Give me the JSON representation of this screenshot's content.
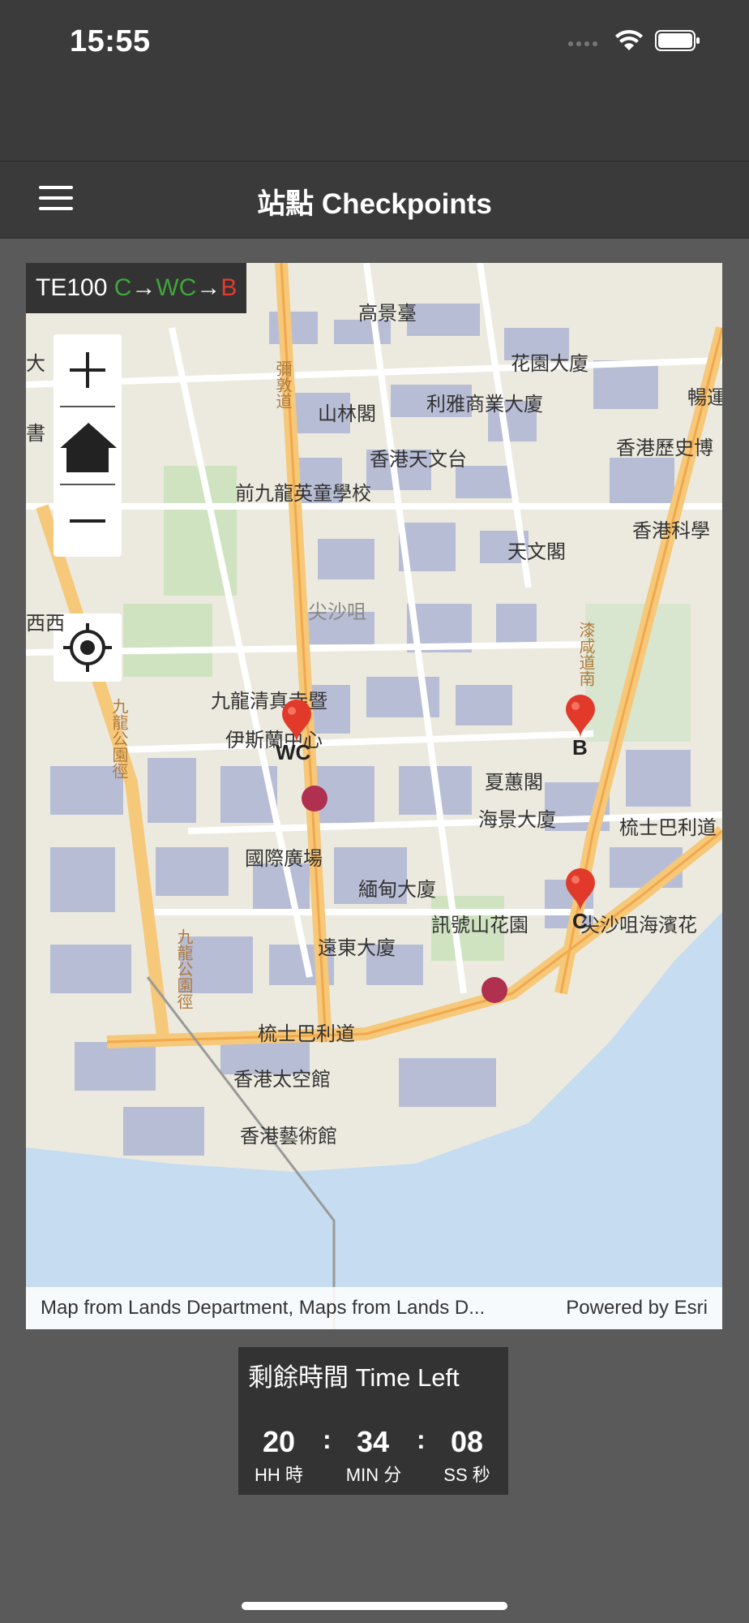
{
  "status_bar": {
    "time": "15:55"
  },
  "nav": {
    "title": "站點 Checkpoints"
  },
  "map": {
    "route": {
      "prefix": "TE100 ",
      "s1": "C",
      "a1": "→",
      "s2": "WC",
      "a2": "→",
      "s3": "B"
    },
    "labels": [
      "高景臺",
      "花園大廈",
      "山林閣",
      "利雅商業大廈",
      "暢運",
      "香港天文台",
      "香港歷史博",
      "前九龍英童學校",
      "香港科學",
      "天文閣",
      "尖沙咀",
      "九龍清真寺暨",
      "伊斯蘭中心",
      "夏蕙閣",
      "海景大廈",
      "梳士巴利道",
      "國際廣場",
      "緬甸大廈",
      "訊號山花園",
      "尖沙咀海濱花",
      "遠東大廈",
      "梳士巴利道",
      "香港太空館",
      "香港藝術館",
      "彌敦道",
      "漆咸道南",
      "九龍公園徑",
      "九龍公園徑",
      "大",
      "書",
      "西西"
    ],
    "pins": [
      {
        "label": "WC"
      },
      {
        "label": "B"
      },
      {
        "label": "C"
      }
    ],
    "attribution_left": "Map from Lands Department, Maps from Lands D...",
    "attribution_right": "Powered by Esri"
  },
  "timer": {
    "title": "剩餘時間 Time Left",
    "hh": "20",
    "mm": "34",
    "ss": "08",
    "hh_unit": "HH 時",
    "mm_unit": "MIN 分",
    "ss_unit": "SS 秒",
    "colon": ":"
  },
  "colors": {
    "green": "#3fa63a",
    "red": "#e53a2c",
    "pin": "#e23a2a"
  }
}
